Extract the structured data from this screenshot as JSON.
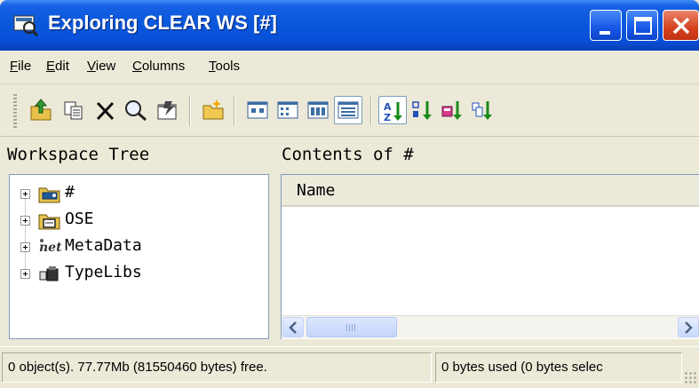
{
  "window": {
    "title": "Exploring CLEAR WS [#]"
  },
  "menu": {
    "items": [
      "File",
      "Edit",
      "View",
      "Columns",
      "Tools"
    ]
  },
  "toolbar": {
    "buttons": [
      "up-folder-icon",
      "copy-icon",
      "delete-icon",
      "find-icon",
      "properties-icon",
      "new-folder-icon",
      "large-icons-view-icon",
      "small-icons-view-icon",
      "list-view-icon",
      "details-view-icon",
      "sort-ascending-icon",
      "sort-descending-icon",
      "sort-by-type-icon",
      "sort-by-size-icon"
    ]
  },
  "tree_pane": {
    "header": "Workspace Tree",
    "items": [
      {
        "label": "#",
        "icon": "workspace-folder-icon"
      },
      {
        "label": "OSE",
        "icon": "ose-folder-icon"
      },
      {
        "label": "MetaData",
        "icon": "net-metadata-icon"
      },
      {
        "label": "TypeLibs",
        "icon": "typelib-icon"
      }
    ]
  },
  "contents_pane": {
    "header": "Contents of #",
    "columns": [
      "Name"
    ]
  },
  "status": {
    "free": "0 object(s). 77.77Mb (81550460 bytes) free.",
    "used": "0 bytes used (0 bytes selec"
  },
  "colors": {
    "title_bar": "#0a58dc",
    "close_button": "#d5421e",
    "chrome": "#ece9d8"
  }
}
